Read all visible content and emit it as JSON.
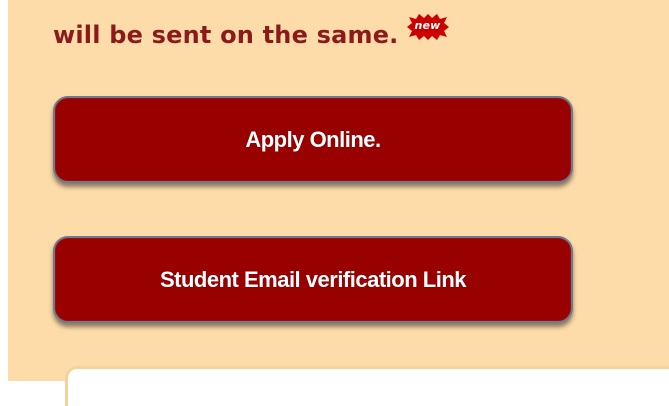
{
  "notice": {
    "text": "will be sent on the same.",
    "badge_text": "new",
    "badge_color": "#cc0000"
  },
  "buttons": {
    "apply_label": "Apply Online.",
    "verify_label": "Student Email verification Link"
  },
  "colors": {
    "panel_background": "#fddcaa",
    "notice_text": "#8b1a1a",
    "button_background": "#990000",
    "button_border": "#6c7b8f"
  }
}
